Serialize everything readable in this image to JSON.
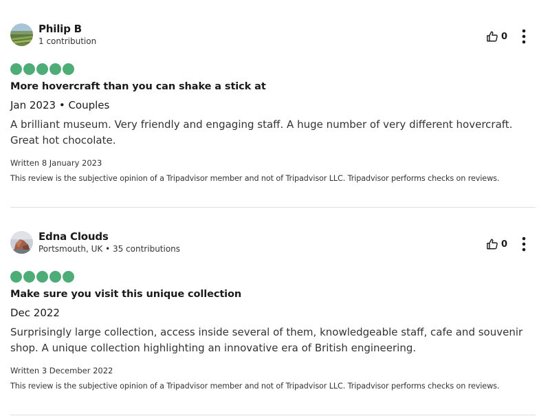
{
  "theme": {
    "bubble_color": "#4ead77",
    "divider_color": "#e0e0e0"
  },
  "reviews": [
    {
      "reviewer": {
        "name": "Philip B",
        "meta": "1 contribution",
        "avatar": "landscape-avatar"
      },
      "helpful_count": "0",
      "rating": 5,
      "title": "More hovercraft than you can shake a stick at",
      "trip_info": "Jan 2023 • Couples",
      "body": "A brilliant museum. Very friendly and engaging staff. A huge number of very different hovercraft. Great hot chocolate.",
      "written": "Written 8 January 2023",
      "disclaimer": "This review is the subjective opinion of a Tripadvisor member and not of Tripadvisor LLC. Tripadvisor performs checks on reviews."
    },
    {
      "reviewer": {
        "name": "Edna Clouds",
        "meta": "Portsmouth, UK • 35 contributions",
        "avatar": "coastal-rock-avatar"
      },
      "helpful_count": "0",
      "rating": 5,
      "title": "Make sure you visit this unique collection",
      "trip_info": "Dec 2022",
      "body": "Surprisingly large collection, access inside several of them, knowledgeable staff, cafe and souvenir shop. A unique collection highlighting an innovative era of British engineering.",
      "written": "Written 3 December 2022",
      "disclaimer": "This review is the subjective opinion of a Tripadvisor member and not of Tripadvisor LLC. Tripadvisor performs checks on reviews."
    }
  ]
}
